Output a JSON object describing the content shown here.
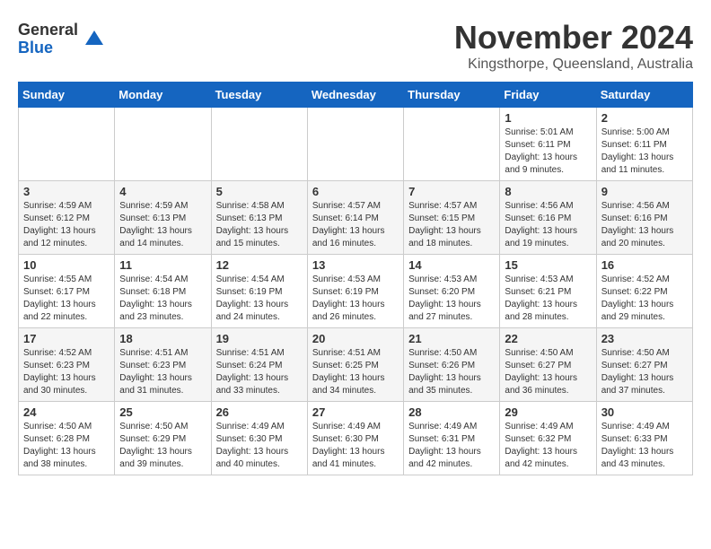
{
  "logo": {
    "general": "General",
    "blue": "Blue"
  },
  "title": "November 2024",
  "subtitle": "Kingsthorpe, Queensland, Australia",
  "weekdays": [
    "Sunday",
    "Monday",
    "Tuesday",
    "Wednesday",
    "Thursday",
    "Friday",
    "Saturday"
  ],
  "weeks": [
    [
      {
        "day": "",
        "info": ""
      },
      {
        "day": "",
        "info": ""
      },
      {
        "day": "",
        "info": ""
      },
      {
        "day": "",
        "info": ""
      },
      {
        "day": "",
        "info": ""
      },
      {
        "day": "1",
        "info": "Sunrise: 5:01 AM\nSunset: 6:11 PM\nDaylight: 13 hours\nand 9 minutes."
      },
      {
        "day": "2",
        "info": "Sunrise: 5:00 AM\nSunset: 6:11 PM\nDaylight: 13 hours\nand 11 minutes."
      }
    ],
    [
      {
        "day": "3",
        "info": "Sunrise: 4:59 AM\nSunset: 6:12 PM\nDaylight: 13 hours\nand 12 minutes."
      },
      {
        "day": "4",
        "info": "Sunrise: 4:59 AM\nSunset: 6:13 PM\nDaylight: 13 hours\nand 14 minutes."
      },
      {
        "day": "5",
        "info": "Sunrise: 4:58 AM\nSunset: 6:13 PM\nDaylight: 13 hours\nand 15 minutes."
      },
      {
        "day": "6",
        "info": "Sunrise: 4:57 AM\nSunset: 6:14 PM\nDaylight: 13 hours\nand 16 minutes."
      },
      {
        "day": "7",
        "info": "Sunrise: 4:57 AM\nSunset: 6:15 PM\nDaylight: 13 hours\nand 18 minutes."
      },
      {
        "day": "8",
        "info": "Sunrise: 4:56 AM\nSunset: 6:16 PM\nDaylight: 13 hours\nand 19 minutes."
      },
      {
        "day": "9",
        "info": "Sunrise: 4:56 AM\nSunset: 6:16 PM\nDaylight: 13 hours\nand 20 minutes."
      }
    ],
    [
      {
        "day": "10",
        "info": "Sunrise: 4:55 AM\nSunset: 6:17 PM\nDaylight: 13 hours\nand 22 minutes."
      },
      {
        "day": "11",
        "info": "Sunrise: 4:54 AM\nSunset: 6:18 PM\nDaylight: 13 hours\nand 23 minutes."
      },
      {
        "day": "12",
        "info": "Sunrise: 4:54 AM\nSunset: 6:19 PM\nDaylight: 13 hours\nand 24 minutes."
      },
      {
        "day": "13",
        "info": "Sunrise: 4:53 AM\nSunset: 6:19 PM\nDaylight: 13 hours\nand 26 minutes."
      },
      {
        "day": "14",
        "info": "Sunrise: 4:53 AM\nSunset: 6:20 PM\nDaylight: 13 hours\nand 27 minutes."
      },
      {
        "day": "15",
        "info": "Sunrise: 4:53 AM\nSunset: 6:21 PM\nDaylight: 13 hours\nand 28 minutes."
      },
      {
        "day": "16",
        "info": "Sunrise: 4:52 AM\nSunset: 6:22 PM\nDaylight: 13 hours\nand 29 minutes."
      }
    ],
    [
      {
        "day": "17",
        "info": "Sunrise: 4:52 AM\nSunset: 6:23 PM\nDaylight: 13 hours\nand 30 minutes."
      },
      {
        "day": "18",
        "info": "Sunrise: 4:51 AM\nSunset: 6:23 PM\nDaylight: 13 hours\nand 31 minutes."
      },
      {
        "day": "19",
        "info": "Sunrise: 4:51 AM\nSunset: 6:24 PM\nDaylight: 13 hours\nand 33 minutes."
      },
      {
        "day": "20",
        "info": "Sunrise: 4:51 AM\nSunset: 6:25 PM\nDaylight: 13 hours\nand 34 minutes."
      },
      {
        "day": "21",
        "info": "Sunrise: 4:50 AM\nSunset: 6:26 PM\nDaylight: 13 hours\nand 35 minutes."
      },
      {
        "day": "22",
        "info": "Sunrise: 4:50 AM\nSunset: 6:27 PM\nDaylight: 13 hours\nand 36 minutes."
      },
      {
        "day": "23",
        "info": "Sunrise: 4:50 AM\nSunset: 6:27 PM\nDaylight: 13 hours\nand 37 minutes."
      }
    ],
    [
      {
        "day": "24",
        "info": "Sunrise: 4:50 AM\nSunset: 6:28 PM\nDaylight: 13 hours\nand 38 minutes."
      },
      {
        "day": "25",
        "info": "Sunrise: 4:50 AM\nSunset: 6:29 PM\nDaylight: 13 hours\nand 39 minutes."
      },
      {
        "day": "26",
        "info": "Sunrise: 4:49 AM\nSunset: 6:30 PM\nDaylight: 13 hours\nand 40 minutes."
      },
      {
        "day": "27",
        "info": "Sunrise: 4:49 AM\nSunset: 6:30 PM\nDaylight: 13 hours\nand 41 minutes."
      },
      {
        "day": "28",
        "info": "Sunrise: 4:49 AM\nSunset: 6:31 PM\nDaylight: 13 hours\nand 42 minutes."
      },
      {
        "day": "29",
        "info": "Sunrise: 4:49 AM\nSunset: 6:32 PM\nDaylight: 13 hours\nand 42 minutes."
      },
      {
        "day": "30",
        "info": "Sunrise: 4:49 AM\nSunset: 6:33 PM\nDaylight: 13 hours\nand 43 minutes."
      }
    ]
  ]
}
